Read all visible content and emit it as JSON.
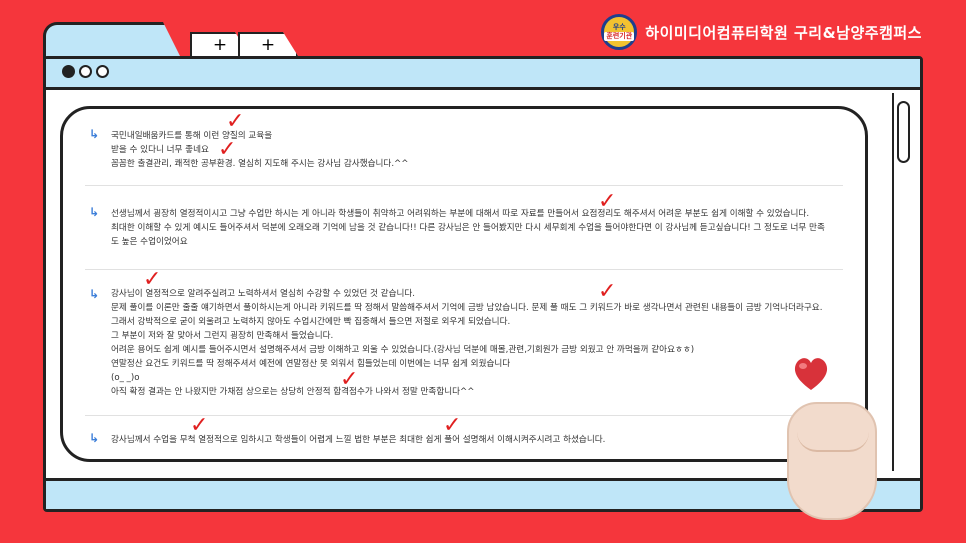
{
  "brand": {
    "name": "하이미디어컴퓨터학원 구리&남양주캠퍼스",
    "badge_top": "우수",
    "badge_bottom": "훈련기관"
  },
  "browser": {
    "tab_plus_1": "+",
    "tab_plus_2": "+"
  },
  "reviews": [
    {
      "text": "국민내일배움카드를 통해 이런 양질의 교육을\n받을 수 있다니 너무 좋네요\n꼼꼼한 출결관리, 쾌적한 공부환경. 열심히 지도해 주시는 강사님 감사했습니다.^^"
    },
    {
      "text": "선생님께서 굉장히 열정적이시고 그냥 수업만 하시는 게 아니라 학생들이 취약하고 어려워하는 부분에 대해서 따로 자료를 만들어서 요점정리도 해주셔서 어려운 부분도 쉽게 이해할 수 있었습니다.\n최대한 이해할 수 있게 예시도 들어주셔서 덕분에 오래오래 기억에 남을 것 같습니다!! 다른 강사님은 안 들어봤지만 다시 세무회계 수업을 들어야한다면 이 강사님께 듣고싶습니다! 그 정도로 너무 만족\n도 높은 수업이었어요"
    },
    {
      "text": "강사님이 열정적으로 알려주실려고 노력하셔서 열심히 수강할 수 있었던 것 같습니다.\n문제 풀이를 이론만 줄줄 얘기하면서 풀이하시는게 아니라 키워드를 딱 정해서 말씀해주셔서 기억에 금방 남았습니다. 문제 풀 때도 그 키워드가 바로 생각나면서 관련된 내용들이 금방 기억나더라구요.\n그래서 강박적으로 굳이 외울려고 노력하지 않아도 수업시간에만 빡 집중해서 들으면 저절로 외우게 되었습니다.\n그 부분이 저와 잘 맞아서 그런지 굉장히 만족해서 들었습니다.\n 어려운 용어도 쉽게 예시를 들어주시면서 설명해주셔서 금방 이해하고 외울 수 있었습니다.(강사님 덕분에 매몰,관련,기회원가 금방 외웠고 안 까먹을꺼 같아요ㅎㅎ)\n연말정산 요건도 키워드를 딱 정해주셔서 예전에 연말정산 못 외워서 힘들었는데 이번에는 너무 쉽게 외웠습니다\n(o_ _)o\n아직 확정 결과는 안 나왔지만 가채점 상으로는 상당히 안정적 합격점수가 나와서 정말 만족합니다^^"
    },
    {
      "text": "강사님께서 수업을 무척 열정적으로 임하시고 학생들이 어렵게 느낄 법한 부분은 최대한 쉽게 풀어 설명해서 이해시켜주시려고 하셨습니다."
    }
  ],
  "colors": {
    "background": "#f5363c",
    "window_chrome": "#bfe6f8",
    "arrow": "#3d7fd9",
    "check": "#e02020"
  }
}
